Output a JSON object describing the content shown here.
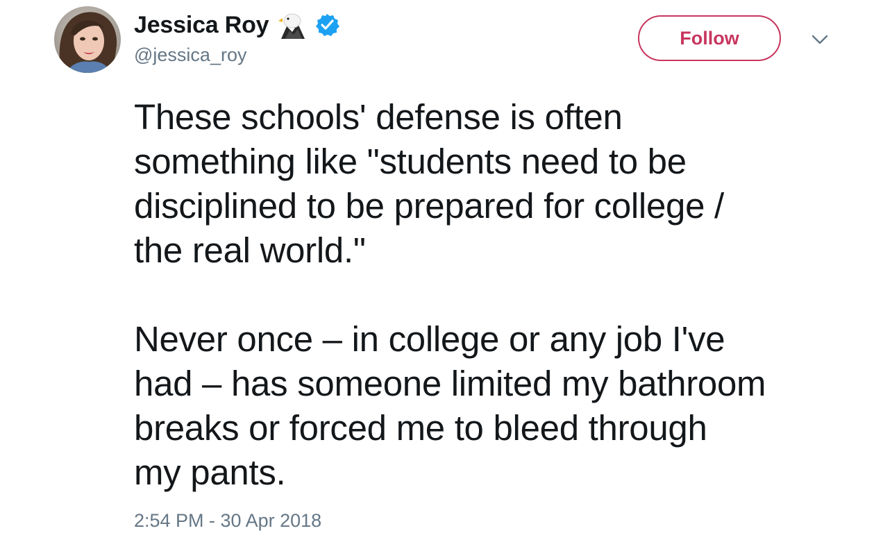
{
  "author": {
    "display_name": "Jessica Roy",
    "handle": "@jessica_roy",
    "name_emoji": "eagle-emoji",
    "verified": true
  },
  "actions": {
    "follow_label": "Follow",
    "more_icon": "chevron-down-icon"
  },
  "tweet": {
    "lines_para1": [
      "These schools' defense is often",
      "something like \"students need to be",
      "disciplined to be prepared for college /",
      "the real world.\""
    ],
    "lines_para2": [
      "Never once – in college or any job I've",
      "had – has someone limited my bathroom",
      "breaks or forced me to bleed through",
      "my pants."
    ],
    "timestamp": "2:54 PM - 30 Apr 2018"
  },
  "colors": {
    "text": "#14171a",
    "secondary": "#657786",
    "follow_accent": "#c7365f",
    "verified_blue": "#1da1f2"
  }
}
